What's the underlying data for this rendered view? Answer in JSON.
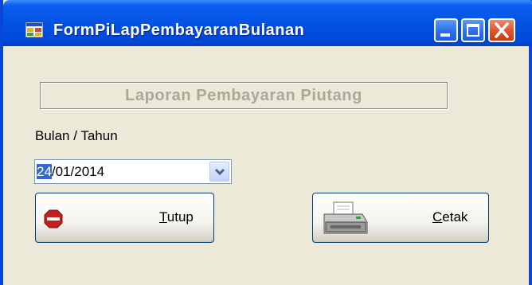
{
  "window": {
    "title": "FormPiLapPembayaranBulanan",
    "icons": {
      "app": "app-icon",
      "minimize": "minimize-icon",
      "maximize": "maximize-icon",
      "close": "close-icon"
    }
  },
  "form": {
    "heading": "Laporan Pembayaran Piutang",
    "period_label": "Bulan / Tahun",
    "date": {
      "selected_part": "24",
      "rest": "/01/2014",
      "dropdown_icon": "chevron-down-icon"
    }
  },
  "buttons": {
    "close": {
      "icon": "stop-sign-icon",
      "mnemonic": "T",
      "label_rest": "utup"
    },
    "print": {
      "icon": "printer-icon",
      "mnemonic": "C",
      "label_rest": "etak"
    }
  },
  "colors": {
    "titlebar": "#0553e3",
    "close_button": "#e0522e",
    "window_bg": "#ece9d8",
    "selection": "#316ac5"
  }
}
